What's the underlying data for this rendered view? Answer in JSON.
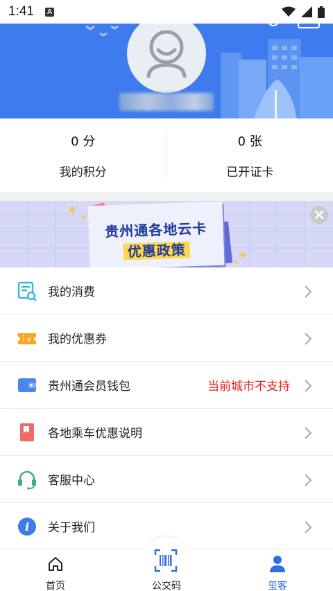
{
  "status_bar": {
    "time": "1:41",
    "notification_glyph": "A",
    "icons": [
      "wifi-icon",
      "signal-icon",
      "battery-icon"
    ]
  },
  "header": {
    "background_color": "#3d7bef",
    "avatar_icon": "default-avatar-icon",
    "username_blurred": true
  },
  "stats": [
    {
      "value": "0 分",
      "label": "我的积分"
    },
    {
      "value": "0 张",
      "label": "已开证卡"
    }
  ],
  "banner": {
    "title_line1": "贵州通各地云卡",
    "title_line2": "优惠政策",
    "close_icon": "close-icon"
  },
  "menu": [
    {
      "label": "我的消费",
      "icon": "consumption-icon",
      "note": ""
    },
    {
      "label": "我的优惠券",
      "icon": "coupon-icon",
      "note": ""
    },
    {
      "label": "贵州通会员钱包",
      "icon": "wallet-icon",
      "note": "当前城市不支持"
    },
    {
      "label": "各地乘车优惠说明",
      "icon": "bookmark-icon",
      "note": ""
    },
    {
      "label": "客服中心",
      "icon": "headset-icon",
      "note": ""
    },
    {
      "label": "关于我们",
      "icon": "info-icon",
      "note": ""
    }
  ],
  "bottom_nav": [
    {
      "label": "首页",
      "icon": "home-icon",
      "active": false
    },
    {
      "label": "公交码",
      "icon": "qr-scan-icon",
      "active": false
    },
    {
      "label": "玺客",
      "icon": "user-icon",
      "active": true
    }
  ],
  "colors": {
    "accent": "#2f6fe0",
    "warning_text": "#e8211c"
  }
}
